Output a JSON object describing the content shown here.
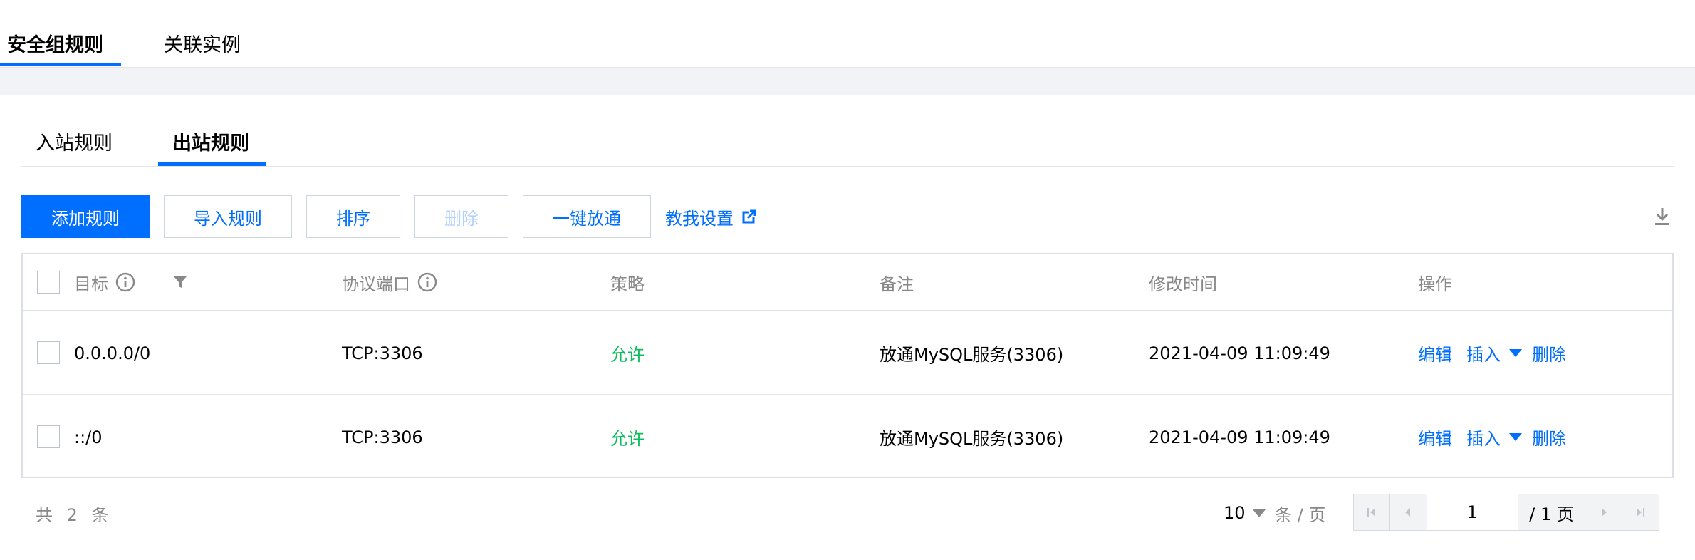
{
  "top_tabs": [
    {
      "label": "安全组规则",
      "active": true
    },
    {
      "label": "关联实例",
      "active": false
    }
  ],
  "sub_tabs": [
    {
      "label": "入站规则",
      "active": false
    },
    {
      "label": "出站规则",
      "active": true
    }
  ],
  "toolbar": {
    "add_rule": "添加规则",
    "import_rules": "导入规则",
    "sort": "排序",
    "delete": "删除",
    "one_click_open": "一键放通",
    "help_setup": "教我设置",
    "download_icon": "download-icon"
  },
  "table": {
    "headers": {
      "target": "目标",
      "protocol_port": "协议端口",
      "policy": "策略",
      "remark": "备注",
      "modified_time": "修改时间",
      "actions": "操作"
    },
    "rows": [
      {
        "target": "0.0.0.0/0",
        "protocol_port": "TCP:3306",
        "policy": "允许",
        "remark": "放通MySQL服务(3306)",
        "modified_time": "2021-04-09 11:09:49",
        "edit": "编辑",
        "insert": "插入",
        "delete": "删除"
      },
      {
        "target": "::/0",
        "protocol_port": "TCP:3306",
        "policy": "允许",
        "remark": "放通MySQL服务(3306)",
        "modified_time": "2021-04-09 11:09:49",
        "edit": "编辑",
        "insert": "插入",
        "delete": "删除"
      }
    ]
  },
  "pagination": {
    "total_text": "共 2 条",
    "page_size": "10",
    "per_page_label": "条 / 页",
    "current_page": "1",
    "total_pages_text": "/ 1 页"
  },
  "colors": {
    "accent": "#006eff",
    "allow": "#0abf5b"
  }
}
